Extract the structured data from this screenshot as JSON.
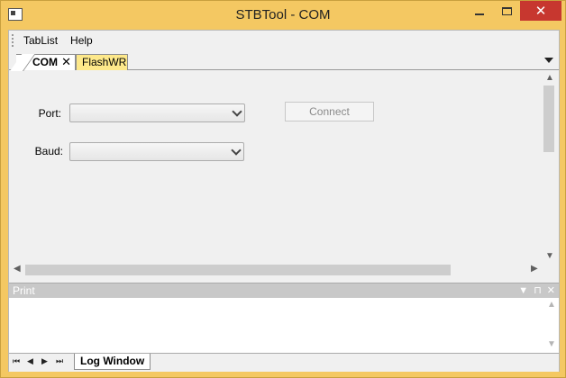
{
  "window": {
    "title": "STBTool - COM",
    "minimize_icon": "minimize-icon",
    "maximize_icon": "maximize-icon",
    "close_glyph": "✕"
  },
  "menubar": {
    "items": [
      {
        "label": "TabList"
      },
      {
        "label": "Help"
      }
    ]
  },
  "tabs": [
    {
      "label": "COM",
      "close_glyph": "✕",
      "active": true
    },
    {
      "label": "FlashWR",
      "active": false
    }
  ],
  "form": {
    "port_label": "Port:",
    "port_value": "",
    "baud_label": "Baud:",
    "baud_value": "",
    "connect_label": "Connect"
  },
  "dock": {
    "title": "Print",
    "icons": [
      "▼",
      "⊓",
      "✕"
    ]
  },
  "bottom": {
    "nav": [
      "⏮",
      "◀",
      "▶",
      "⏭"
    ],
    "log_tab_label": "Log Window"
  },
  "colors": {
    "titlebar": "#f4c862",
    "close_button": "#c7372f",
    "active_tab_flash": "#fde88a",
    "dock_header": "#c8c8c8"
  }
}
